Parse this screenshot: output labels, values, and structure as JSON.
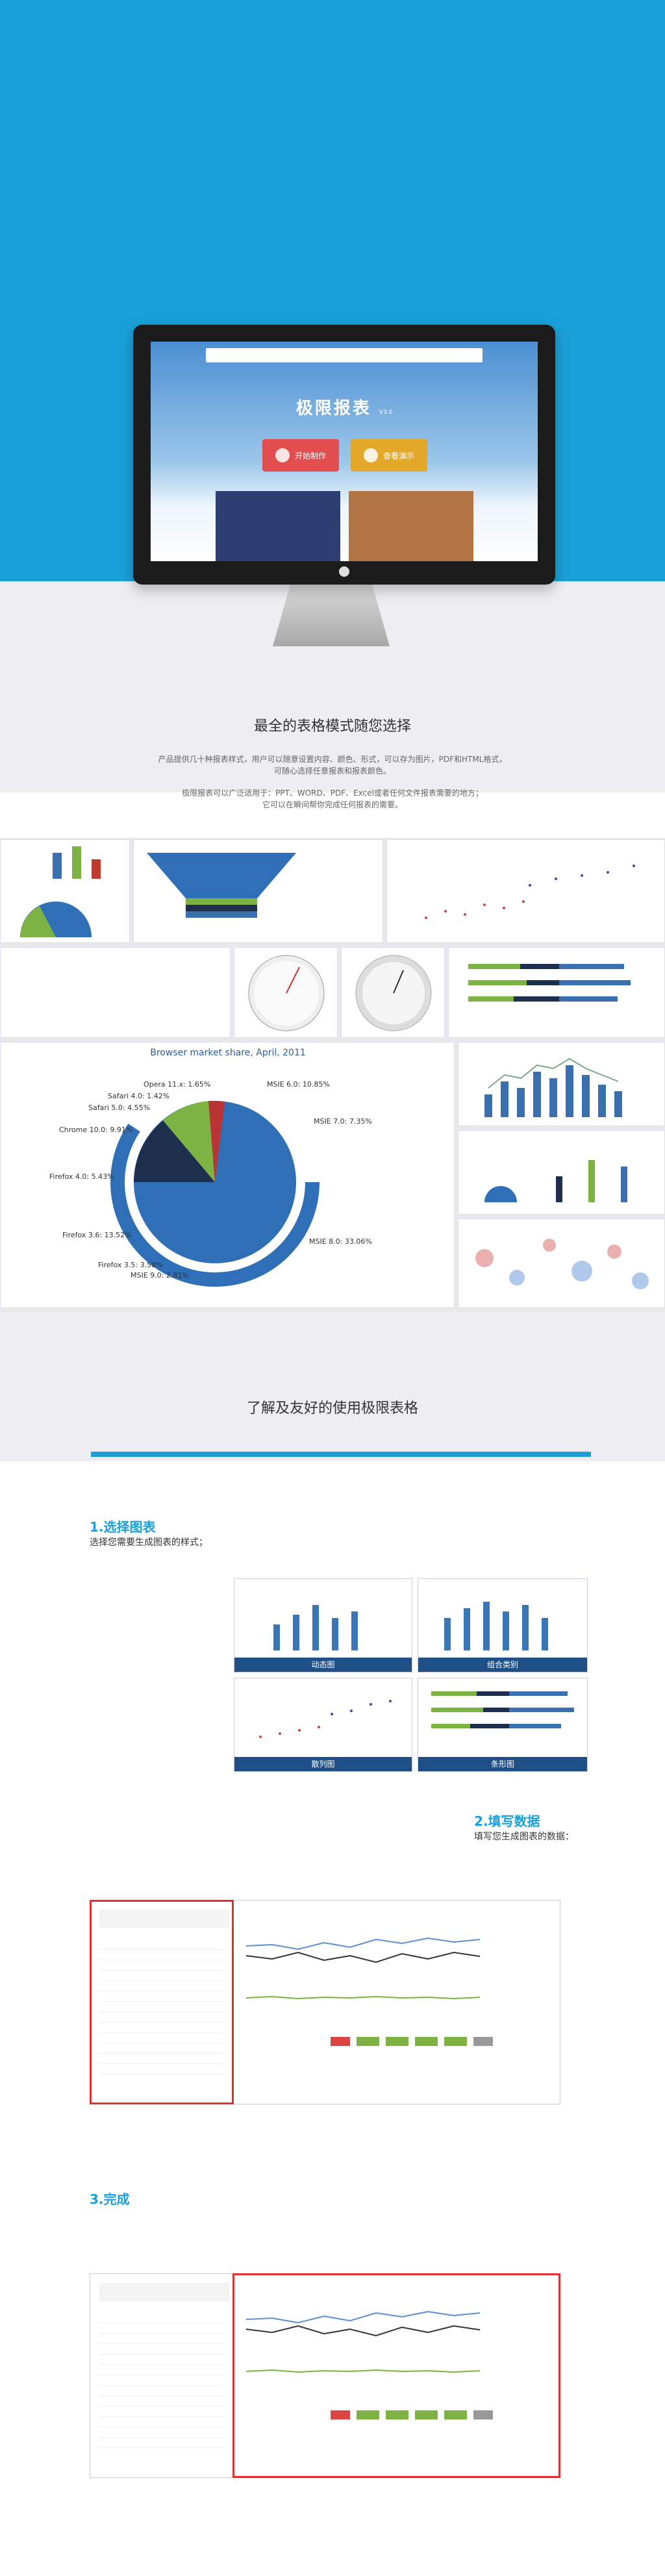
{
  "hero": {
    "nav": [
      "",
      "",
      "",
      "",
      ""
    ],
    "brand": "极限报表",
    "brand_version": "V3.0",
    "tagline": "",
    "buttons": [
      "开始制作",
      "查看演示"
    ]
  },
  "section1": {
    "title": "最全的表格模式随您选择",
    "p1": "产品提供几十种报表样式，用户可以随意设置内容、颜色、形式，可以存为图片，PDF和HTML格式，",
    "p2": "可随心选择任意报表和报表颜色。",
    "p3": "极限报表可以广泛适用于：PPT、WORD、PDF、Excel或者任何文件报表需要的地方；",
    "p4": "它可以在瞬间帮你完成任何报表的需要。"
  },
  "pie": {
    "title": "Browser market share, April, 2011",
    "labels": [
      {
        "t": "Opera 11.x: 1.65%"
      },
      {
        "t": "Safari 4.0: 1.42%"
      },
      {
        "t": "Safari 5.0: 4.55%"
      },
      {
        "t": "Chrome 10.0: 9.91%"
      },
      {
        "t": "Firefox 4.0: 5.43%"
      },
      {
        "t": "Firefox 3.6: 13.52%"
      },
      {
        "t": "Firefox 3.5: 3.58%"
      },
      {
        "t": "MSIE 9.0: 2.81%"
      },
      {
        "t": "MSIE 8.0: 33.06%"
      },
      {
        "t": "MSIE 7.0: 7.35%"
      },
      {
        "t": "MSIE 6.0: 10.85%"
      }
    ]
  },
  "section2": {
    "title": "了解及友好的使用极限表格"
  },
  "steps": {
    "s1_title": "1.选择图表",
    "s1_desc": "选择您需要生成图表的样式；",
    "s1_thumbs": [
      "动态图",
      "组合类别",
      "散列图",
      "条形图"
    ],
    "s2_title": "2.填写数据",
    "s2_desc": "填写您生成图表的数据：",
    "s3_title": "3.完成"
  },
  "colors": {
    "accent": "#1aa0d8",
    "highlight": "#e03030"
  }
}
